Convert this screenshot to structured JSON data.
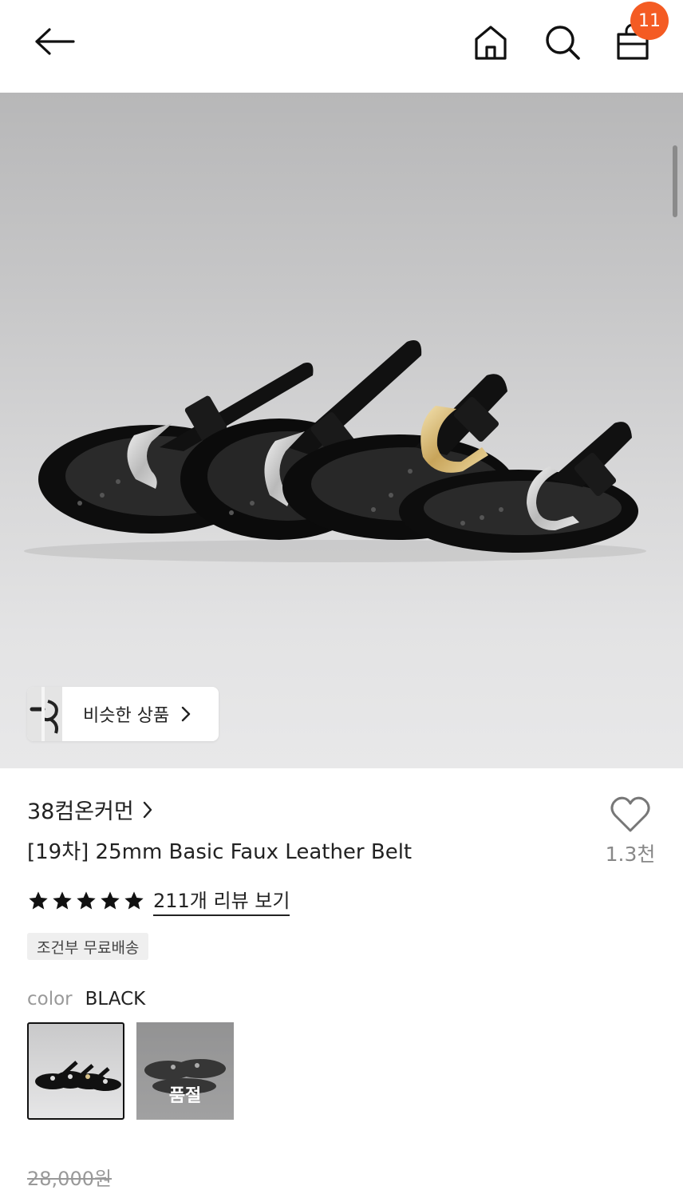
{
  "header": {
    "back_icon": "arrow-left-icon",
    "home_icon": "home-icon",
    "search_icon": "search-icon",
    "cart_icon": "shopping-bag-icon",
    "cart_count": "11",
    "badge_color": "#f45b23"
  },
  "hero": {
    "image": "four black faux leather belts with silver and gold buckles on grey backdrop",
    "similar_button_label": "비슷한 상품"
  },
  "product": {
    "brand": "38컴온커먼",
    "title": "[19차] 25mm Basic Faux Leather Belt",
    "wishlist_icon": "heart-outline-icon",
    "wishlist_count": "1.3천",
    "rating_stars": 5,
    "review_link": "211개 리뷰 보기",
    "shipping_badge": "조건부 무료배송",
    "color_label": "color",
    "color_value": "BLACK",
    "swatches": [
      {
        "selected": true,
        "sold_out": false
      },
      {
        "selected": false,
        "sold_out": true,
        "label": "품절"
      }
    ],
    "original_price": "28,000원"
  }
}
